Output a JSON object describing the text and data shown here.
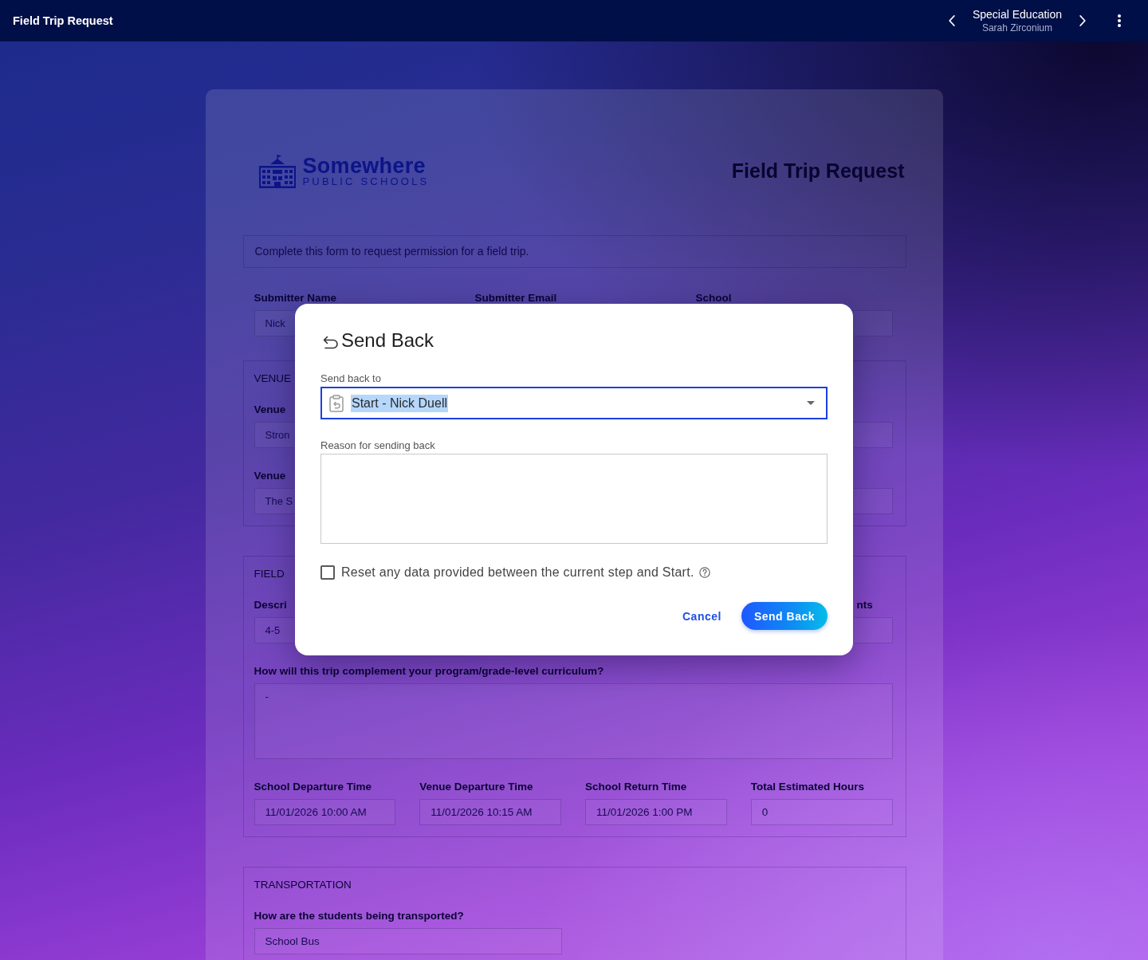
{
  "top_bar": {
    "title": "Field Trip Request",
    "context": {
      "title": "Special Education",
      "subtitle": "Sarah Zirconium"
    }
  },
  "form": {
    "logo": {
      "name": "Somewhere",
      "tagline": "PUBLIC SCHOOLS"
    },
    "title": "Field Trip Request",
    "description": "Complete this form to request permission for a field trip.",
    "header": {
      "labels": [
        "Submitter Name",
        "Submitter Email",
        "School"
      ],
      "value": "Nick"
    },
    "sections": [
      {
        "heading": "VENUE",
        "fields": [
          {
            "kind": "split",
            "label": "Venue",
            "value": "Stron"
          },
          {
            "kind": "split",
            "label": "Venue",
            "value": "The S"
          }
        ]
      },
      {
        "heading": "FIELD",
        "fields": [
          {
            "kind": "split",
            "label": "Descri",
            "value": "4-5",
            "right_label": "nts"
          },
          {
            "kind": "textarea",
            "label": "How will this trip complement your program/grade-level curriculum?",
            "value": "-"
          },
          {
            "kind": "columns",
            "columns": [
              {
                "label": "School Departure Time",
                "value": "11/01/2026 10:00 AM"
              },
              {
                "label": "Venue Departure Time",
                "value": "11/01/2026 10:15 AM"
              },
              {
                "label": "School Return Time",
                "value": "11/01/2026 1:00 PM"
              },
              {
                "label": "Total Estimated Hours",
                "value": "0"
              }
            ]
          }
        ]
      },
      {
        "heading": "TRANSPORTATION",
        "fields": [
          {
            "kind": "half",
            "label": "How are the students being transported?",
            "value": "School Bus"
          }
        ]
      }
    ]
  },
  "dialog": {
    "title": "Send Back",
    "send_back_to": {
      "label": "Send back to",
      "value": "Start - Nick Duell",
      "focused": true
    },
    "reason": {
      "label": "Reason for sending back"
    },
    "reset_option": {
      "label": "Reset any data provided between the current step and Start.",
      "checked": false
    },
    "buttons": [
      {
        "label": "Cancel",
        "kind": "text"
      },
      {
        "label": "Send Back",
        "kind": "primary"
      }
    ]
  }
}
